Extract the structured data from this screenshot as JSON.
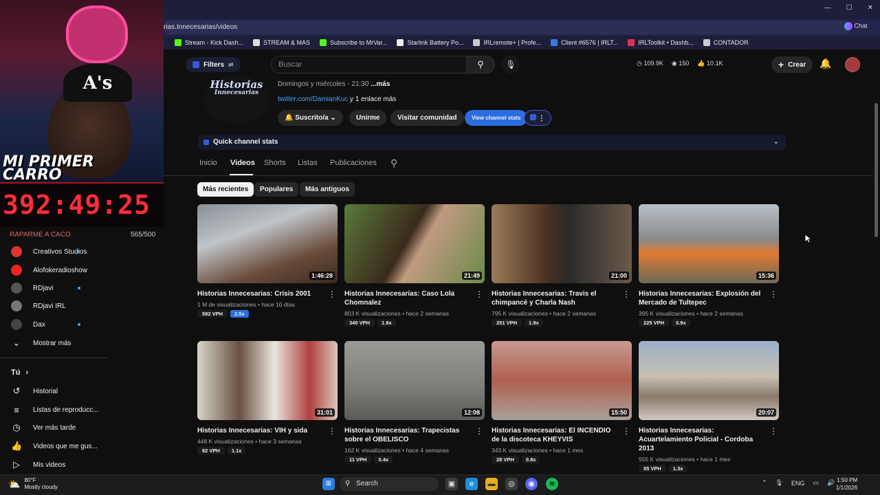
{
  "browser": {
    "url": "rias.Innecesarias/videos",
    "bookmarks": [
      "Stream - Kick Dash...",
      "STREAM & MAS",
      "Subscribe to MrVar...",
      "Starlink Battery Po...",
      "IRLremote+ | Profe...",
      "Client #6576 | IRLT...",
      "IRLToolkit • Dashb...",
      "CONTADOR"
    ],
    "chat_label": "Chat"
  },
  "stream_overlay": {
    "title_line1": "MI PRIMER",
    "title_line2": "CARRO",
    "cap_text": "A's",
    "timer": "392:49:25",
    "goal_label": "RAPARME A CACO",
    "goal_count": "565/500"
  },
  "sidebar": {
    "subscriptions": [
      {
        "label": "Creativos Studios",
        "color": "#d33",
        "dot": true
      },
      {
        "label": "Alofokeradioshow",
        "color": "#e22",
        "dot": false
      },
      {
        "label": "RDjavi",
        "color": "#555",
        "dot": true
      },
      {
        "label": "RDjavi IRL",
        "color": "#777",
        "dot": false
      },
      {
        "label": "Dax",
        "color": "#444",
        "dot": true
      }
    ],
    "show_more": "Mostrar más",
    "you_header": "Tú",
    "you_items": [
      {
        "label": "Historial",
        "icon": "history-icon",
        "glyph": "↺"
      },
      {
        "label": "Listas de reproducc...",
        "icon": "playlists-icon",
        "glyph": "≡"
      },
      {
        "label": "Ver más tarde",
        "icon": "watch-later-icon",
        "glyph": "◷"
      },
      {
        "label": "Videos que me gus...",
        "icon": "like-icon",
        "glyph": "👍"
      },
      {
        "label": "Mis videos",
        "icon": "my-videos-icon",
        "glyph": "▷"
      }
    ]
  },
  "header": {
    "filters_label": "Filters",
    "search_placeholder": "Buscar",
    "stats": [
      "109.9K",
      "150",
      "10.1K"
    ],
    "create_label": "Crear"
  },
  "channel": {
    "logo_line1": "Historias",
    "logo_line2": "Innecesarias",
    "schedule": "Domingos y miércoles - 21:30",
    "schedule_more": "...más",
    "link": "twitter.com/DamianKuc",
    "link_extra": " y 1 enlace más",
    "subscribed_label": "Suscrito/a",
    "join_label": "Unirme",
    "community_label": "Visitar comunidad",
    "view_stats_label": "View channel stats",
    "quick_stats_label": "Quick channel stats"
  },
  "tabs": [
    "Inicio",
    "Videos",
    "Shorts",
    "Listas",
    "Publicaciones"
  ],
  "chips": [
    "Más recientes",
    "Populares",
    "Más antiguos"
  ],
  "videos": [
    {
      "title": "Historias Innecesarias: Crisis 2001",
      "duration": "1:46:28",
      "views": "1 M de visualizaciones",
      "age": "hace 10 días",
      "vph": "592 VPH",
      "mult": "2.5x",
      "hot": true,
      "thumb": "linear-gradient(160deg,#8a8f96 0%,#bfc4c8 35%,#6a4c3a 70%,#3a2a20 100%)"
    },
    {
      "title": "Historias Innecesarias: Caso Lola Chomnalez",
      "duration": "21:49",
      "views": "803 K visualizaciones",
      "age": "hace 2 semanas",
      "vph": "340 VPH",
      "mult": "1.9x",
      "hot": false,
      "thumb": "linear-gradient(120deg,#5a7a3a 0%,#3a2a1c 45%,#c09a80 55%,#6a8a4a 100%)"
    },
    {
      "title": "Historias Innecesarias: Travis el chimpancé y Charla Nash",
      "duration": "21:00",
      "views": "795 K visualizaciones",
      "age": "hace 2 semanas",
      "vph": "251 VPH",
      "mult": "1.9x",
      "hot": false,
      "thumb": "linear-gradient(90deg,#9a7a5a 0%,#4a3020 40%,#2a2a2a 55%,#6a5a4a 100%)"
    },
    {
      "title": "Historias Innecesarias: Explosión del Mercado de Tultepec",
      "duration": "15:36",
      "views": "395 K visualizaciones",
      "age": "hace 2 semanas",
      "vph": "225 VPH",
      "mult": "0.9x",
      "hot": false,
      "thumb": "linear-gradient(180deg,#b8c0c8 0%,#8a8a8a 45%,#e07a30 62%,#6a6a5a 100%)"
    },
    {
      "title": "Historias Innecesarias: VIH y sida",
      "duration": "31:01",
      "views": "448 K visualizaciones",
      "age": "hace 3 semanas",
      "vph": "82 VPH",
      "mult": "1.1x",
      "hot": false,
      "thumb": "linear-gradient(90deg,#d8d4cc 0%,#6a5040 30%,#eae6e0 55%,#b04040 80%,#d8c8b8 100%)"
    },
    {
      "title": "Historias Innecesarias: Trapecistas sobre el OBELISCO",
      "duration": "12:08",
      "views": "162 K visualizaciones",
      "age": "hace 4 semanas",
      "vph": "11 VPH",
      "mult": "0.4x",
      "hot": false,
      "thumb": "linear-gradient(180deg,#9a9a96 0%,#7c7c78 60%,#5a5a56 100%)"
    },
    {
      "title": "Historias Innecesarias: El INCENDIO de la discoteca KHEYVIS",
      "duration": "15:50",
      "views": "343 K visualizaciones",
      "age": "hace 1 mes",
      "vph": "28 VPH",
      "mult": "0.8x",
      "hot": false,
      "thumb": "linear-gradient(180deg,#c89a90 0%,#b06050 50%,#a8a098 100%)"
    },
    {
      "title": "Historias Innecesarias: Acuartelamiento Policial - Cordoba 2013",
      "duration": "20:07",
      "views": "555 K visualizaciones",
      "age": "hace 1 mes",
      "vph": "55 VPH",
      "mult": "1.3x",
      "hot": false,
      "thumb": "linear-gradient(180deg,#9ab0c8 0%,#c8c0b0 45%,#8a7a6a 70%,#d0c8c0 100%)"
    }
  ],
  "taskbar": {
    "temp": "80°F",
    "weather": "Mostly cloudy",
    "search_label": "Search",
    "lang": "ENG",
    "time": "1:50 PM",
    "date": "1/1/2026"
  }
}
